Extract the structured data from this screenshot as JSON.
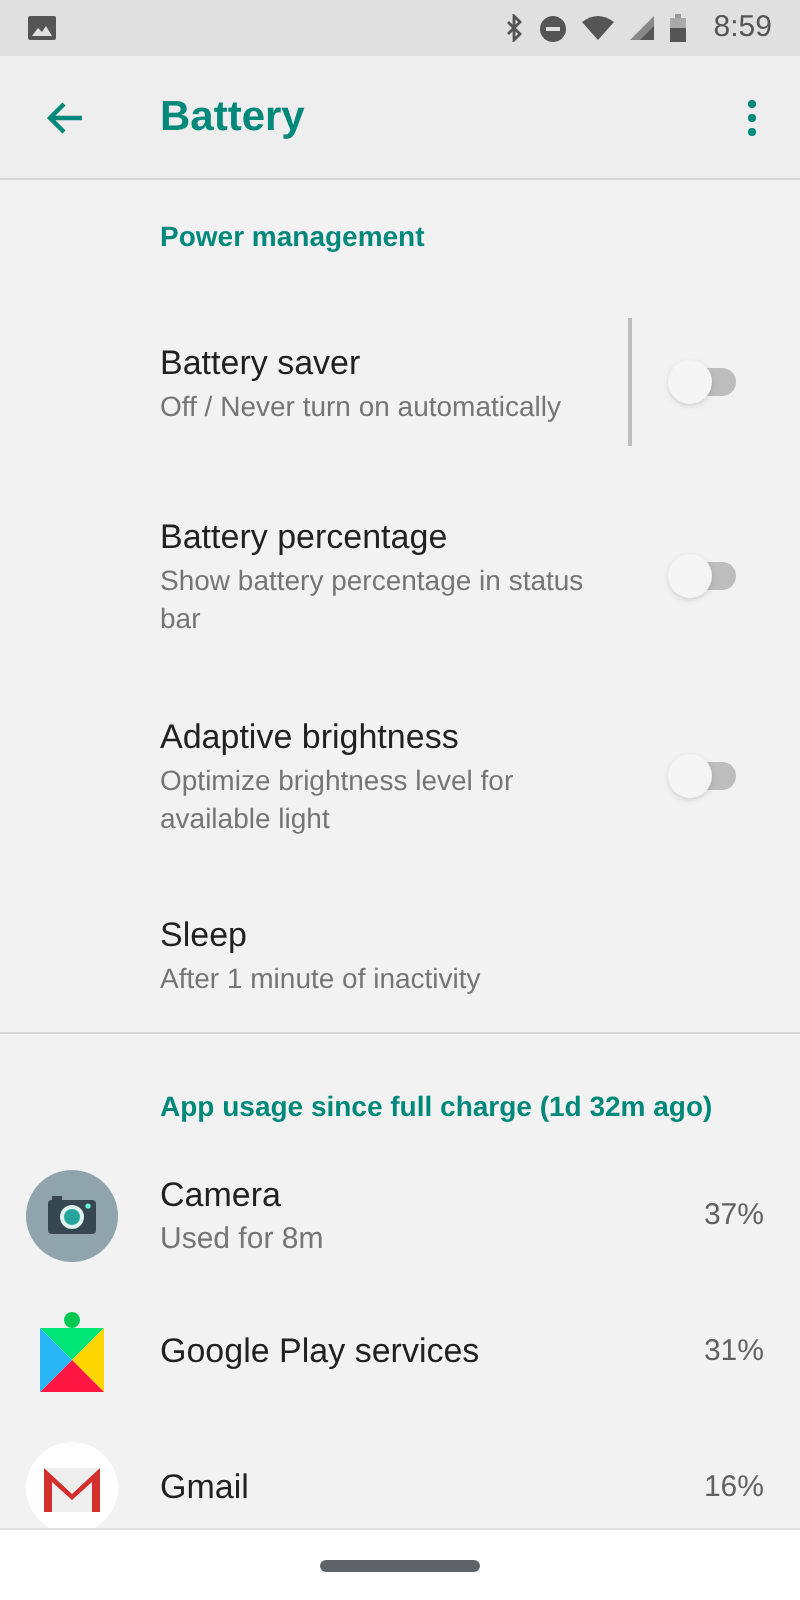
{
  "status_bar": {
    "time": "8:59"
  },
  "app_bar": {
    "title": "Battery"
  },
  "power_section": {
    "title": "Power management",
    "items": [
      {
        "kind": "toggle",
        "title": "Battery saver",
        "summary": "Off / Never turn on automatically",
        "on": false,
        "divider": true
      },
      {
        "kind": "toggle",
        "title": "Battery percentage",
        "summary": "Show battery percentage in status bar",
        "on": false,
        "divider": false
      },
      {
        "kind": "toggle",
        "title": "Adaptive brightness",
        "summary": "Optimize brightness level for available light",
        "on": false,
        "divider": false
      },
      {
        "kind": "plain",
        "title": "Sleep",
        "summary": "After 1 minute of inactivity"
      }
    ]
  },
  "usage_section": {
    "title": "App usage since full charge (1d 32m ago)",
    "apps": [
      {
        "name": "Camera",
        "detail": "Used for 8m",
        "percent": "37%"
      },
      {
        "name": "Google Play services",
        "percent": "31%"
      },
      {
        "name": "Gmail",
        "percent": "16%"
      }
    ]
  }
}
